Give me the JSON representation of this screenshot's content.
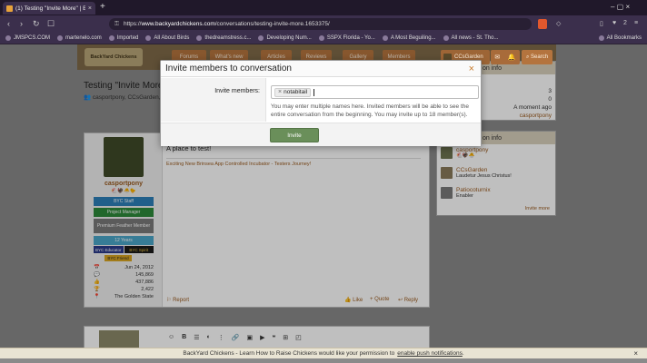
{
  "browser": {
    "tab_title": "(1) Testing \"Invite More\" | B",
    "tab_close": "×",
    "new_tab": "+",
    "url_scheme": "https://",
    "url_host": "www.backyardchickens.com",
    "url_path": "/conversations/testing-invite-more.1653375/",
    "notif_count": "2",
    "window_ctl": "–  ▢  ×"
  },
  "bookmarks": {
    "items": [
      "JMSPCS.COM",
      "martenelo.com",
      "Imported",
      "All About Birds",
      "thedreamstress.c...",
      "Developing Num...",
      "SSPX Florida - Yo...",
      "A Most Beguiling...",
      "All news - St. Tho..."
    ],
    "right": "All Bookmarks"
  },
  "site": {
    "logo": "BackYard Chickens",
    "nav": [
      "Forums",
      "What's new",
      "Articles",
      "Reviews",
      "Gallery",
      "Members"
    ],
    "user": "CCsGarden",
    "search": "Search"
  },
  "conversation": {
    "title": "Testing \"Invite More\"",
    "participants_line": "casportpony, CCsGarden,"
  },
  "convo_info": {
    "heading": "on info",
    "rows": [
      "3",
      "0",
      "A moment ago",
      "casportpony"
    ]
  },
  "participants": {
    "heading": "on info",
    "list": [
      {
        "name": "casportpony",
        "sub": ""
      },
      {
        "name": "CCsGarden",
        "sub": "Laudetur Jesus Christus!"
      },
      {
        "name": "Patiocoturnix",
        "sub": "Enabler"
      }
    ],
    "invite_more": "Invite more"
  },
  "message": {
    "author": "casportpony",
    "badges": [
      "BYC Staff",
      "Project Manager",
      "Premium Feather Member",
      "12 Years",
      "BYC Educator",
      "BYC Spirit",
      "BYC Friend"
    ],
    "stats": [
      {
        "icon": "📅",
        "value": "Jun 24, 2012"
      },
      {
        "icon": "💬",
        "value": "145,869"
      },
      {
        "icon": "👍",
        "value": "437,886"
      },
      {
        "icon": "🏆",
        "value": "2,422"
      },
      {
        "icon": "📍",
        "value": "The Golden State"
      }
    ],
    "body": "A place to test!",
    "signature": "Exciting New Brinsea App Controlled Incubator - Testers Journey!",
    "report": "Report",
    "like": "Like",
    "quote": "Quote",
    "reply": "Reply"
  },
  "modal": {
    "title": "Invite members to conversation",
    "close": "×",
    "label": "Invite members:",
    "token": "notabitail",
    "help": "You may enter multiple names here. Invited members will be able to see the entire conversation from the beginning. You may invite up to 18 member(s).",
    "submit": "Invite"
  },
  "notification": {
    "text": "BackYard Chickens - Learn How to Raise Chickens would like your permission to",
    "link": "enable push notifications",
    "tail": ".",
    "close": "×"
  },
  "colors": {
    "accent": "#9a5a1e",
    "invite_button": "#6a8f5a",
    "nav_button": "#b4743e"
  }
}
